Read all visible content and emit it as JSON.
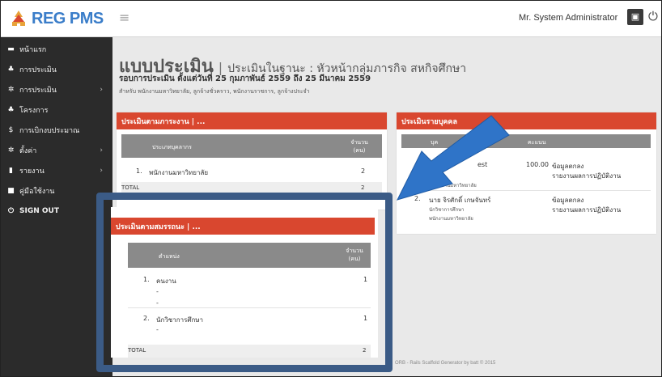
{
  "brand": {
    "name": "REG PMS"
  },
  "header": {
    "user": "Mr. System Administrator"
  },
  "sidebar": {
    "items": [
      {
        "label": "หน้าแรก"
      },
      {
        "label": "การประเมิน"
      },
      {
        "label": "การประเมิน"
      },
      {
        "label": "โครงการ"
      },
      {
        "label": "การเบิกงบประมาณ"
      },
      {
        "label": "ตั้งค่า"
      },
      {
        "label": "รายงาน"
      },
      {
        "label": "คู่มือใช้งาน"
      },
      {
        "label": "SIGN OUT"
      }
    ]
  },
  "page": {
    "title": "แบบประเมิน",
    "separator": "|",
    "subtitle": "ประเมินในฐานะ : หัวหน้ากลุ่มภารกิจ สหกิจศึกษา",
    "period": "รอบการประเมิน ตั้งแต่วันที่ 25 กุมภาพันธ์ 2559 ถึง 25 มีนาคม 2559",
    "for_who": "สำหรับ พนักงานมหาวิทยาลัย, ลูกจ้างชั่วคราว, พนักงานราชการ, ลูกจ้างประจำ"
  },
  "panel_workload": {
    "title": "ประเมินตามภาระงาน | ...",
    "col_type": "ประเภทบุคลากร",
    "col_count": "จำนวน (คน)",
    "rows": [
      {
        "num": "1.",
        "name": "พนักงานมหาวิทยาลัย",
        "count": "2"
      }
    ],
    "total_label": "TOTAL",
    "total_value": "2"
  },
  "panel_competency": {
    "title": "ประเมินตามสมรรถนะ | ...",
    "col_position": "ตำแหน่ง",
    "col_count": "จำนวน (คน)",
    "rows": [
      {
        "num": "1.",
        "name": "คนงาน",
        "count": "1",
        "dash1": "-",
        "dash2": "-"
      },
      {
        "num": "2.",
        "name": "นักวิชาการศึกษา",
        "count": "1",
        "dash1": "-"
      }
    ],
    "total_label": "TOTAL",
    "total_value": "2"
  },
  "panel_individual": {
    "title": "ประเมินรายบุคคล",
    "col_person": "บุค",
    "col_score": "คะแนน",
    "rows": [
      {
        "name_fragment": "est",
        "org": "นักงานมหาวิทยาลัย",
        "score": "100.00",
        "link1": "ข้อมูลตกลง",
        "link2": "รายงานผลการปฏิบัติงาน"
      },
      {
        "num": "2.",
        "name": "นาย จิรศักดิ์ เกษจันทร์",
        "role": "นักวิชาการศึกษา",
        "org": "พนักงานมหาวิทยาลัย",
        "score": "",
        "link1": "ข้อมูลตกลง",
        "link2": "รายงานผลการปฏิบัติงาน"
      }
    ]
  },
  "footer": {
    "text": "ORB - Rails Scaffold Generator by batt © 2015"
  },
  "colors": {
    "accent": "#d9472f",
    "brand": "#3a7dc9",
    "sidebar": "#2b2b2b",
    "highlight": "#3b5b86",
    "arrow": "#2f74c8"
  }
}
